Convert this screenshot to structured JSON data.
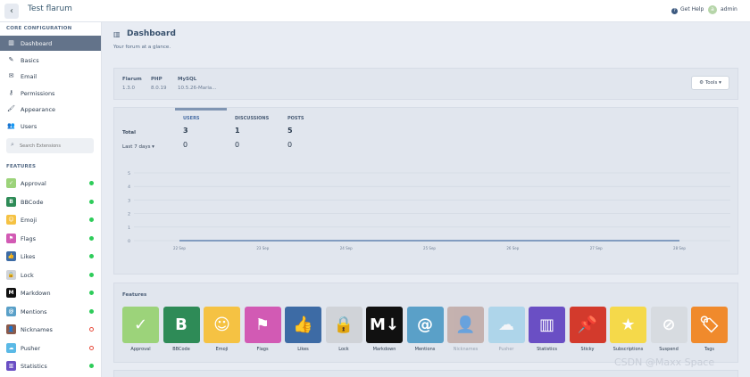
{
  "topbar": {
    "back": "‹",
    "title": "Test flarum",
    "help": "Get Help",
    "avatar_letter": "a",
    "user": "admin"
  },
  "sidebar": {
    "core_title": "CORE CONFIGURATION",
    "core_items": [
      {
        "label": "Dashboard",
        "icon": "chart-icon",
        "glyph": "▥",
        "active": true
      },
      {
        "label": "Basics",
        "icon": "pencil-icon",
        "glyph": "✎"
      },
      {
        "label": "Email",
        "icon": "envelope-icon",
        "glyph": "✉"
      },
      {
        "label": "Permissions",
        "icon": "key-icon",
        "glyph": "⚷"
      },
      {
        "label": "Appearance",
        "icon": "paintbrush-icon",
        "glyph": "🖌"
      },
      {
        "label": "Users",
        "icon": "users-icon",
        "glyph": "👥"
      }
    ],
    "search_placeholder": "Search Extensions",
    "features_title": "FEATURES",
    "features": [
      {
        "label": "Approval",
        "color": "#9cd37a",
        "glyph": "✓",
        "enabled": true
      },
      {
        "label": "BBCode",
        "color": "#2e8b57",
        "glyph": "B",
        "enabled": true
      },
      {
        "label": "Emoji",
        "color": "#f5c243",
        "glyph": "☺",
        "enabled": true
      },
      {
        "label": "Flags",
        "color": "#d25ab4",
        "glyph": "⚑",
        "enabled": true
      },
      {
        "label": "Likes",
        "color": "#3d6ba5",
        "glyph": "👍",
        "enabled": true
      },
      {
        "label": "Lock",
        "color": "#d0d3d8",
        "glyph": "🔒",
        "enabled": true
      },
      {
        "label": "Markdown",
        "color": "#111111",
        "glyph": "M",
        "enabled": true
      },
      {
        "label": "Mentions",
        "color": "#5aa0c8",
        "glyph": "@",
        "enabled": true
      },
      {
        "label": "Nicknames",
        "color": "#8b5a4a",
        "glyph": "👤",
        "enabled": false
      },
      {
        "label": "Pusher",
        "color": "#5ab9e6",
        "glyph": "☁",
        "enabled": false
      },
      {
        "label": "Statistics",
        "color": "#6a4fc4",
        "glyph": "▥",
        "enabled": true
      }
    ]
  },
  "header": {
    "title": "Dashboard",
    "subtitle": "Your forum at a glance."
  },
  "versions": [
    {
      "name": "Flarum",
      "value": "1.3.0"
    },
    {
      "name": "PHP",
      "value": "8.0.19"
    },
    {
      "name": "MySQL",
      "value": "10.5.26-Maria..."
    }
  ],
  "tools_label": "Tools ▾",
  "stats": {
    "tabs": [
      "USERS",
      "DISCUSSIONS",
      "POSTS"
    ],
    "total_label": "Total",
    "period_label": "Last 7 days ▾",
    "totals": [
      "3",
      "1",
      "5"
    ],
    "period": [
      "0",
      "0",
      "0"
    ]
  },
  "chart_data": {
    "type": "line",
    "x": [
      "22 Sep",
      "23 Sep",
      "24 Sep",
      "25 Sep",
      "26 Sep",
      "27 Sep",
      "28 Sep"
    ],
    "series": [
      {
        "values": [
          0,
          0,
          0,
          0,
          0,
          0,
          0
        ]
      }
    ],
    "yticks": [
      "5",
      "4",
      "3",
      "2",
      "1",
      "0"
    ],
    "ylim": [
      0,
      5
    ],
    "grid": true,
    "color": "#4a6fa5"
  },
  "features_panel": {
    "title": "Features",
    "items": [
      {
        "label": "Approval",
        "color": "#9cd37a",
        "glyph": "✓",
        "enabled": true,
        "icon": "check-icon"
      },
      {
        "label": "BBCode",
        "color": "#2e8b57",
        "glyph": "B",
        "enabled": true,
        "icon": "bbcode-icon"
      },
      {
        "label": "Emoji",
        "color": "#f5c243",
        "glyph": "☺",
        "enabled": true,
        "icon": "smile-icon"
      },
      {
        "label": "Flags",
        "color": "#d25ab4",
        "glyph": "⚑",
        "enabled": true,
        "icon": "flag-icon"
      },
      {
        "label": "Likes",
        "color": "#3d6ba5",
        "glyph": "👍",
        "enabled": true,
        "icon": "thumbs-up-icon"
      },
      {
        "label": "Lock",
        "color": "#d0d3d8",
        "glyph": "🔒",
        "enabled": true,
        "icon": "lock-icon"
      },
      {
        "label": "Markdown",
        "color": "#111111",
        "glyph": "M↓",
        "enabled": true,
        "icon": "markdown-icon"
      },
      {
        "label": "Mentions",
        "color": "#5aa0c8",
        "glyph": "@",
        "enabled": true,
        "icon": "at-icon"
      },
      {
        "label": "Nicknames",
        "color": "#b28f86",
        "glyph": "👤",
        "enabled": false,
        "icon": "user-tag-icon"
      },
      {
        "label": "Pusher",
        "color": "#8dcbe8",
        "glyph": "☁",
        "enabled": false,
        "icon": "pusher-icon"
      },
      {
        "label": "Statistics",
        "color": "#6a4fc4",
        "glyph": "▥",
        "enabled": true,
        "icon": "chart-bar-icon"
      },
      {
        "label": "Sticky",
        "color": "#d33a2c",
        "glyph": "📌",
        "enabled": true,
        "icon": "thumbtack-icon"
      },
      {
        "label": "Subscriptions",
        "color": "#f5d94a",
        "glyph": "★",
        "enabled": true,
        "icon": "star-icon"
      },
      {
        "label": "Suspend",
        "color": "#d7dbe0",
        "glyph": "⊘",
        "enabled": true,
        "icon": "ban-icon"
      },
      {
        "label": "Tags",
        "color": "#f08a2c",
        "glyph": "🏷",
        "enabled": true,
        "icon": "tags-icon"
      }
    ]
  },
  "watermark": "CSDN @Maxx Space"
}
